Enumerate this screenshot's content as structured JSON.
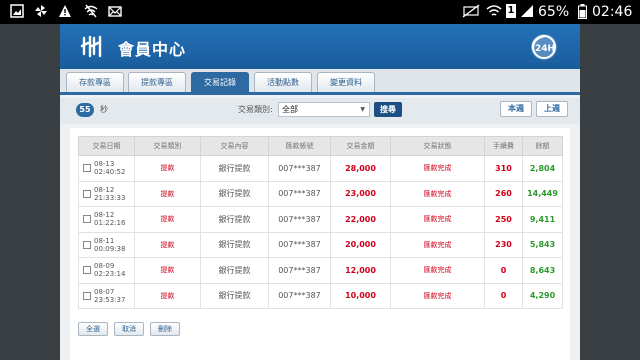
{
  "status_bar": {
    "battery_percent": "65%",
    "time": "02:46",
    "sim_badge": "1"
  },
  "header": {
    "title": "會員中心",
    "support_badge": "24H"
  },
  "tabs": [
    {
      "label": "存款專區"
    },
    {
      "label": "提款專區"
    },
    {
      "label": "交易記錄"
    },
    {
      "label": "活動點數"
    },
    {
      "label": "變更資料"
    }
  ],
  "toolbar": {
    "timer_value": "55",
    "timer_unit": "秒",
    "type_label": "交易類別:",
    "type_selected": "全部",
    "search_label": "搜尋",
    "this_week": "本週",
    "last_week": "上週"
  },
  "table": {
    "headers": [
      "交易日期",
      "交易類別",
      "交易內容",
      "匯款帳號",
      "交易金額",
      "交易狀態",
      "手續費",
      "餘額"
    ],
    "rows": [
      {
        "date": "08-13",
        "time": "02:40:52",
        "type": "提款",
        "content": "銀行提款",
        "account": "007***387",
        "amount": "28,000",
        "status": "匯款完成",
        "fee": "310",
        "balance": "2,804"
      },
      {
        "date": "08-12",
        "time": "21:33:33",
        "type": "提款",
        "content": "銀行提款",
        "account": "007***387",
        "amount": "23,000",
        "status": "匯款完成",
        "fee": "260",
        "balance": "14,449"
      },
      {
        "date": "08-12",
        "time": "01:22:16",
        "type": "提款",
        "content": "銀行提款",
        "account": "007***387",
        "amount": "22,000",
        "status": "匯款完成",
        "fee": "250",
        "balance": "9,411"
      },
      {
        "date": "08-11",
        "time": "00:09:38",
        "type": "提款",
        "content": "銀行提款",
        "account": "007***387",
        "amount": "20,000",
        "status": "匯款完成",
        "fee": "230",
        "balance": "5,843"
      },
      {
        "date": "08-09",
        "time": "02:23:14",
        "type": "提款",
        "content": "銀行提款",
        "account": "007***387",
        "amount": "12,000",
        "status": "匯款完成",
        "fee": "0",
        "balance": "8,643"
      },
      {
        "date": "08-07",
        "time": "23:53:37",
        "type": "提款",
        "content": "銀行提款",
        "account": "007***387",
        "amount": "10,000",
        "status": "匯款完成",
        "fee": "0",
        "balance": "4,290"
      }
    ]
  },
  "footer": {
    "select_all": "全選",
    "cancel": "取消",
    "delete": "刪除"
  },
  "colors": {
    "header_blue": "#1c63a8",
    "active_tab": "#2e6aa2",
    "amount_red": "#d0021b",
    "balance_green": "#2b9a2b"
  }
}
